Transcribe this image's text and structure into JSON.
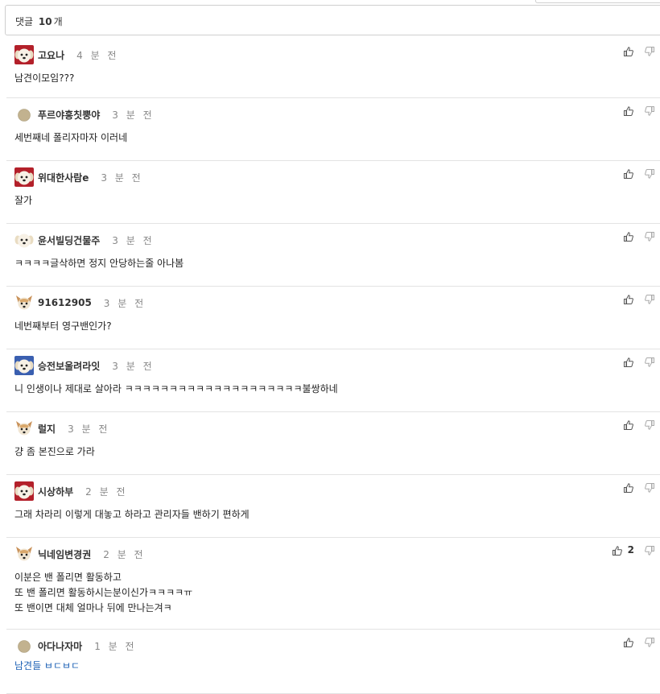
{
  "header": {
    "prefix": "댓글",
    "count": "10",
    "suffix": "개"
  },
  "comments": [
    {
      "avatar": "dog-red",
      "nick": "고요나",
      "time": "4 분 전",
      "lines": [
        "남견이모임???"
      ],
      "likes": ""
    },
    {
      "avatar": "dot",
      "nick": "푸르야흥칫뿡야",
      "time": "3 분 전",
      "lines": [
        "세번째네 폴리자마자 이러네"
      ],
      "likes": ""
    },
    {
      "avatar": "dog-red",
      "nick": "위대한사람e",
      "time": "3 분 전",
      "lines": [
        "잘가"
      ],
      "likes": ""
    },
    {
      "avatar": "dog-plain",
      "nick": "윤서빌딩건물주",
      "time": "3 분 전",
      "lines": [
        "ㅋㅋㅋㅋ글삭하면 정지 안당하는줄 아나봄"
      ],
      "likes": ""
    },
    {
      "avatar": "chihuahua",
      "nick": "91612905",
      "time": "3 분 전",
      "lines": [
        "네번째부터 영구밴인가?"
      ],
      "likes": ""
    },
    {
      "avatar": "dog-blue",
      "nick": "승전보울려라잇",
      "time": "3 분 전",
      "lines": [
        "니 인생이나 제대로 살아라 ㅋㅋㅋㅋㅋㅋㅋㅋㅋㅋㅋㅋㅋㅋㅋㅋㅋㅋㅋㅋ불쌍하네"
      ],
      "likes": ""
    },
    {
      "avatar": "chihuahua",
      "nick": "럴지",
      "time": "3 분 전",
      "lines": [
        "걍 좀 본진으로 가라"
      ],
      "likes": ""
    },
    {
      "avatar": "dog-red",
      "nick": "시상하부",
      "time": "2 분 전",
      "lines": [
        "그래 차라리 이렇게 대놓고 하라고 관리자들 밴하기 편하게"
      ],
      "likes": ""
    },
    {
      "avatar": "chihuahua",
      "nick": "닉네임변경권",
      "time": "2 분 전",
      "lines": [
        "이분은 밴 폴리면 활동하고",
        "또 밴 폴리면 활동하시는분이신가ㅋㅋㅋㅋㅠ",
        "또 밴이면 대체 얼마나 뒤에 만나는겨ㅋ"
      ],
      "likes": "2"
    },
    {
      "avatar": "dot",
      "nick": "아다나자마",
      "time": "1 분 전",
      "lines": [
        "남견들 ㅂㄷㅂㄷ"
      ],
      "likes": "",
      "link": true
    }
  ],
  "icons": {
    "like": "thumbs-up-icon",
    "dislike": "thumbs-down-icon"
  },
  "colors": {
    "border": "#cfcfcf",
    "link": "#1a5fb4",
    "muted": "#888888"
  }
}
